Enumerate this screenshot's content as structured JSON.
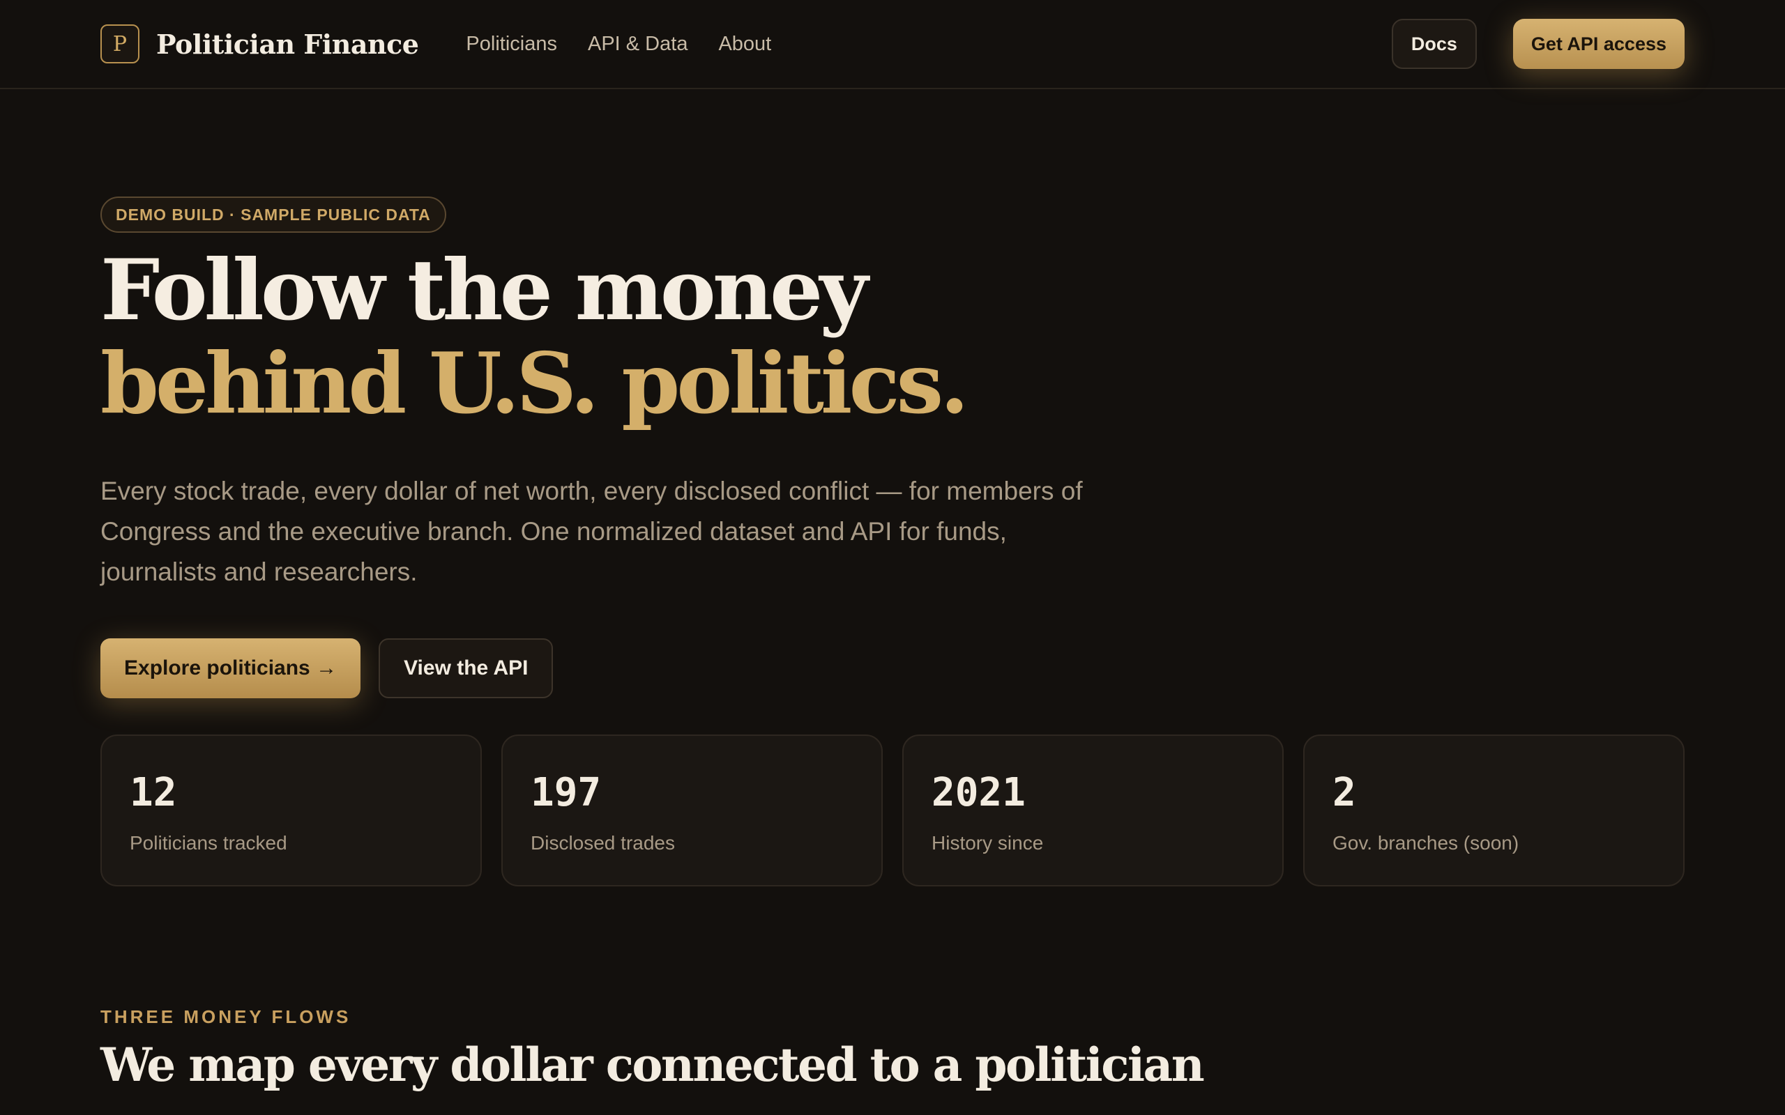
{
  "nav": {
    "logo_letter": "P",
    "brand": "Politician Finance",
    "links": [
      "Politicians",
      "API & Data",
      "About"
    ],
    "docs_label": "Docs",
    "cta_label": "Get API access"
  },
  "hero": {
    "badge": "DEMO BUILD · SAMPLE PUBLIC DATA",
    "headline_line1": "Follow the money",
    "headline_line2": "behind U.S. politics.",
    "subtitle": "Every stock trade, every dollar of net worth, every disclosed conflict — for members of Congress and the executive branch. One normalized dataset and API for funds, journalists and researchers.",
    "primary_cta": "Explore politicians →",
    "secondary_cta": "View the API"
  },
  "stats": [
    {
      "value": "12",
      "label": "Politicians tracked"
    },
    {
      "value": "197",
      "label": "Disclosed trades"
    },
    {
      "value": "2021",
      "label": "History since"
    },
    {
      "value": "2",
      "label": "Gov. branches (soon)"
    }
  ],
  "section": {
    "eyebrow": "THREE MONEY FLOWS",
    "title": "We map every dollar connected to a politician"
  },
  "colors": {
    "background": "#13100d",
    "accent_gold": "#d4af6a",
    "text_primary": "#f3ece0",
    "text_muted": "#a89a86"
  }
}
